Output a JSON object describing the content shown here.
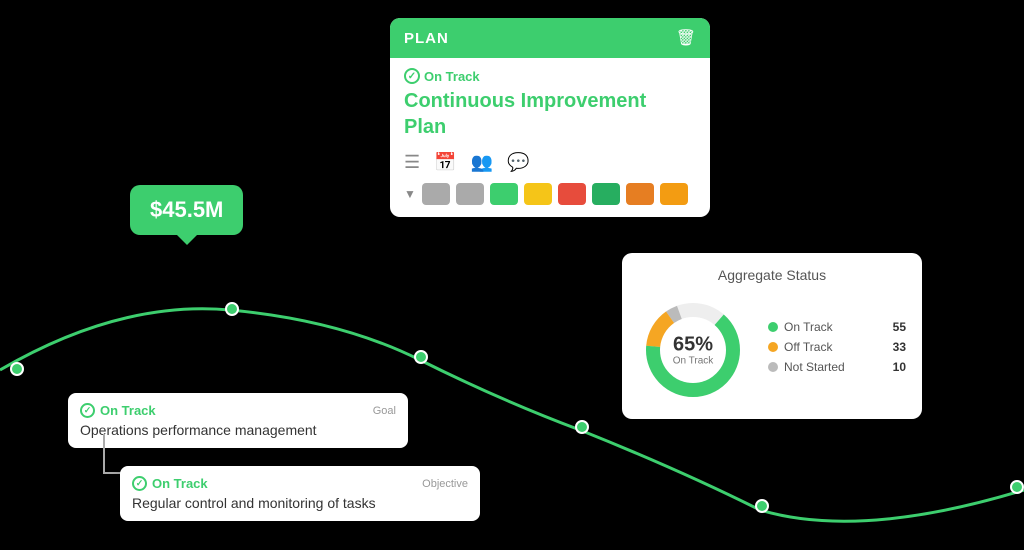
{
  "plan_card": {
    "header_title": "PLAN",
    "on_track_text": "On Track",
    "title_line1": "Continuous Improvement",
    "title_line2": "Plan"
  },
  "money_bubble": {
    "value": "$45.5M"
  },
  "goal_card": {
    "on_track_text": "On Track",
    "type_label": "Goal",
    "description": "Operations performance management"
  },
  "objective_card": {
    "on_track_text": "On Track",
    "type_label": "Objective",
    "description": "Regular control and monitoring of tasks"
  },
  "aggregate": {
    "title": "Aggregate Status",
    "percentage": "65%",
    "percentage_sub": "On Track",
    "legend": [
      {
        "label": "On Track",
        "color": "#3dce6e",
        "count": "55"
      },
      {
        "label": "Off Track",
        "color": "#f5a623",
        "count": "33"
      },
      {
        "label": "Not Started",
        "color": "#bbb",
        "count": "10"
      }
    ]
  },
  "colors": {
    "accent_green": "#3dce6e",
    "swatch_gray": "#aaa",
    "swatch_green": "#3dce6e",
    "swatch_yellow": "#f5c518",
    "swatch_red": "#e74c3c",
    "swatch_dark_green": "#27ae60",
    "swatch_orange": "#e67e22",
    "swatch_amber": "#f39c12"
  }
}
